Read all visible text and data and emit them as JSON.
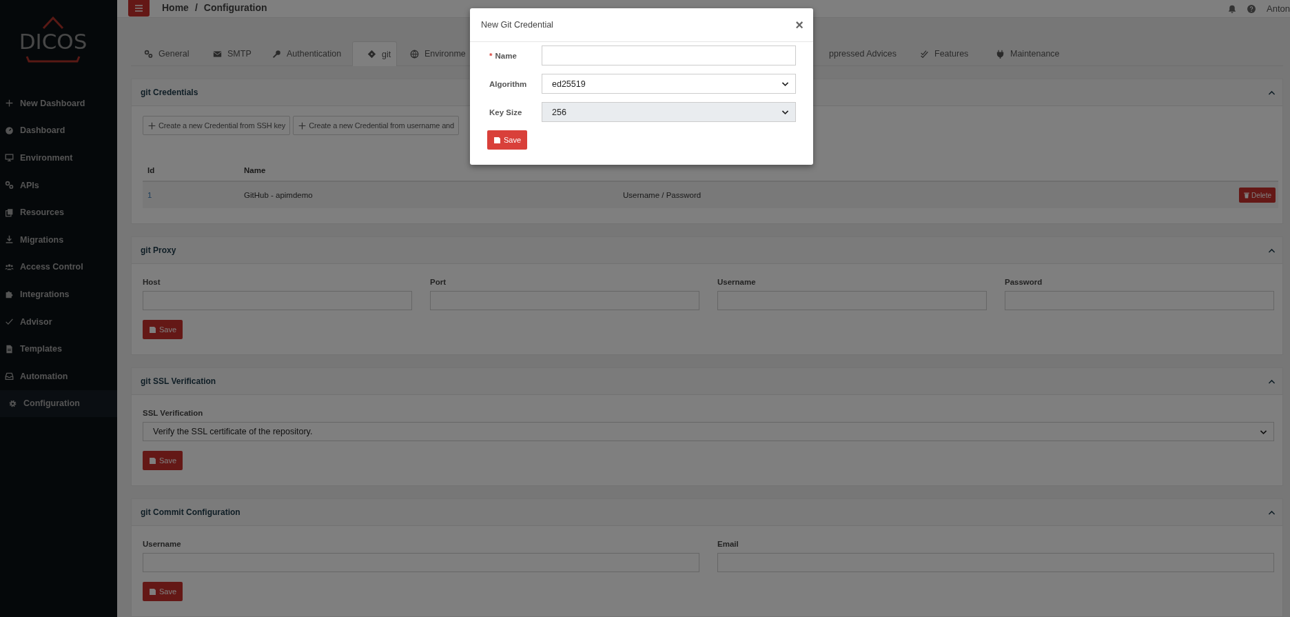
{
  "sidebar": {
    "logo": "DICOS",
    "items": [
      {
        "label": "New Dashboard",
        "selected": false
      },
      {
        "label": "Dashboard",
        "selected": false
      },
      {
        "label": "Environment",
        "selected": false
      },
      {
        "label": "APIs",
        "selected": false
      },
      {
        "label": "Resources",
        "selected": false
      },
      {
        "label": "Migrations",
        "selected": false
      },
      {
        "label": "Access Control",
        "selected": false
      },
      {
        "label": "Integrations",
        "selected": false
      },
      {
        "label": "Advisor",
        "selected": false
      },
      {
        "label": "Templates",
        "selected": false
      },
      {
        "label": "Automation",
        "selected": false
      },
      {
        "label": "Configuration",
        "selected": true
      }
    ]
  },
  "topbar": {
    "breadcrumb": [
      "Home",
      "Configuration"
    ],
    "separator": "/",
    "user": "Anton"
  },
  "tabs": [
    {
      "label": "General",
      "selected": false
    },
    {
      "label": "SMTP",
      "selected": false
    },
    {
      "label": "Authentication",
      "selected": false
    },
    {
      "label": "git",
      "selected": true
    },
    {
      "label": "Environme",
      "selected": false
    },
    {
      "label": "ppressed Advices",
      "selected": false
    },
    {
      "label": "Features",
      "selected": false
    },
    {
      "label": "Maintenance",
      "selected": false
    }
  ],
  "panels": [
    {
      "kind": "table",
      "title": "git Credentials",
      "buttons": [
        "Create a new Credential from SSH key",
        "Create a new Credential from username and"
      ],
      "columns": [
        "Id",
        "Name"
      ],
      "rows": [
        {
          "id": "1",
          "name": "GitHub - apimdemo",
          "type": "Username / Password",
          "action": "Delete"
        }
      ]
    },
    {
      "kind": "form",
      "title": "git Proxy",
      "fields": [
        {
          "kind": "input",
          "label": "Host"
        },
        {
          "kind": "input",
          "label": "Port"
        },
        {
          "kind": "input",
          "label": "Username"
        },
        {
          "kind": "input",
          "label": "Password"
        }
      ],
      "save": "Save"
    },
    {
      "kind": "form",
      "title": "git SSL Verification",
      "fields": [
        {
          "kind": "select",
          "label": "SSL Verification",
          "value": "Verify the SSL certificate of the repository."
        }
      ],
      "save": "Save"
    },
    {
      "kind": "form",
      "title": "git Commit Configuration",
      "fields": [
        {
          "kind": "input",
          "label": "Username"
        },
        {
          "kind": "input",
          "label": "Email"
        }
      ],
      "save": "Save"
    }
  ],
  "modal": {
    "title": "New Git Credential",
    "close": "×",
    "required_mark": "*",
    "fields": [
      {
        "kind": "input",
        "label": "Name",
        "required": true,
        "disabled": false
      },
      {
        "kind": "select",
        "label": "Algorithm",
        "value": "ed25519",
        "required": false,
        "disabled": false
      },
      {
        "kind": "select",
        "label": "Key Size",
        "value": "256",
        "required": false,
        "disabled": true
      }
    ],
    "save": "Save"
  }
}
